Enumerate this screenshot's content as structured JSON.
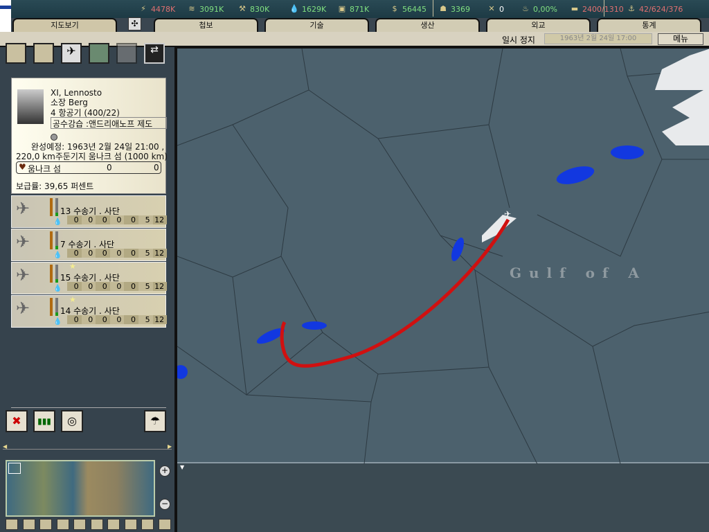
{
  "resources": [
    {
      "icon": "energy-icon",
      "value": "4478K",
      "color": "#e07070"
    },
    {
      "icon": "metal-icon",
      "value": "3091K",
      "color": "#80e080"
    },
    {
      "icon": "rare-materials-icon",
      "value": "830K",
      "color": "#80e080"
    },
    {
      "icon": "oil-icon",
      "value": "1629K",
      "color": "#80e080"
    },
    {
      "icon": "supplies-icon",
      "value": "871K",
      "color": "#80e080"
    },
    {
      "icon": "money-icon",
      "value": "56445",
      "color": "#80e080"
    },
    {
      "icon": "manpower-icon",
      "value": "3369",
      "color": "#80e080"
    },
    {
      "icon": "nuclear-icon",
      "value": "0",
      "color": "#ffffff"
    },
    {
      "icon": "dissent-icon",
      "value": "0,00%",
      "color": "#80e080"
    },
    {
      "icon": "transport-icon",
      "value": "2400/1310",
      "color": "#e07070"
    },
    {
      "icon": "escort-icon",
      "value": "42/624/376",
      "color": "#e07070"
    }
  ],
  "tabs": {
    "map": "지도보기",
    "intel": "첩보",
    "tech": "기술",
    "production": "생산",
    "diplomacy": "외교",
    "stats": "통계"
  },
  "status": {
    "paused": "일시 정지",
    "date": "1963년 2월 24일 17:00",
    "menu": "메뉴"
  },
  "unit_card": {
    "name": "XI, Lennosto",
    "commander": "소장  Berg",
    "type": "4 항공기  (400/22)",
    "mission": "공수강습 :앤드리애노프 제도",
    "eta": "완성예정: 1963년 2월 24일 21:00 ,",
    "distance": "220,0 km",
    "base": "주둔기지 움나크 섬   (1000 km)",
    "location": {
      "name": "움나크 섬",
      "v1": "0",
      "v2": "0"
    },
    "supply": "보급률: 39,65 퍼센트"
  },
  "units": [
    {
      "name": "13 수송기 . 사단",
      "star": false,
      "stats": [
        "0",
        "0",
        "0",
        "0",
        "0",
        "5",
        "12"
      ]
    },
    {
      "name": "7 수송기 . 사단",
      "star": false,
      "stats": [
        "0",
        "0",
        "0",
        "0",
        "0",
        "5",
        "12"
      ]
    },
    {
      "name": "15 수송기 . 사단",
      "star": true,
      "stats": [
        "0",
        "0",
        "0",
        "0",
        "0",
        "5",
        "12"
      ]
    },
    {
      "name": "14 수송기 . 사단",
      "star": true,
      "stats": [
        "0",
        "0",
        "0",
        "0",
        "0",
        "5",
        "12"
      ]
    }
  ],
  "map": {
    "label": "G u l f   o f   A"
  }
}
